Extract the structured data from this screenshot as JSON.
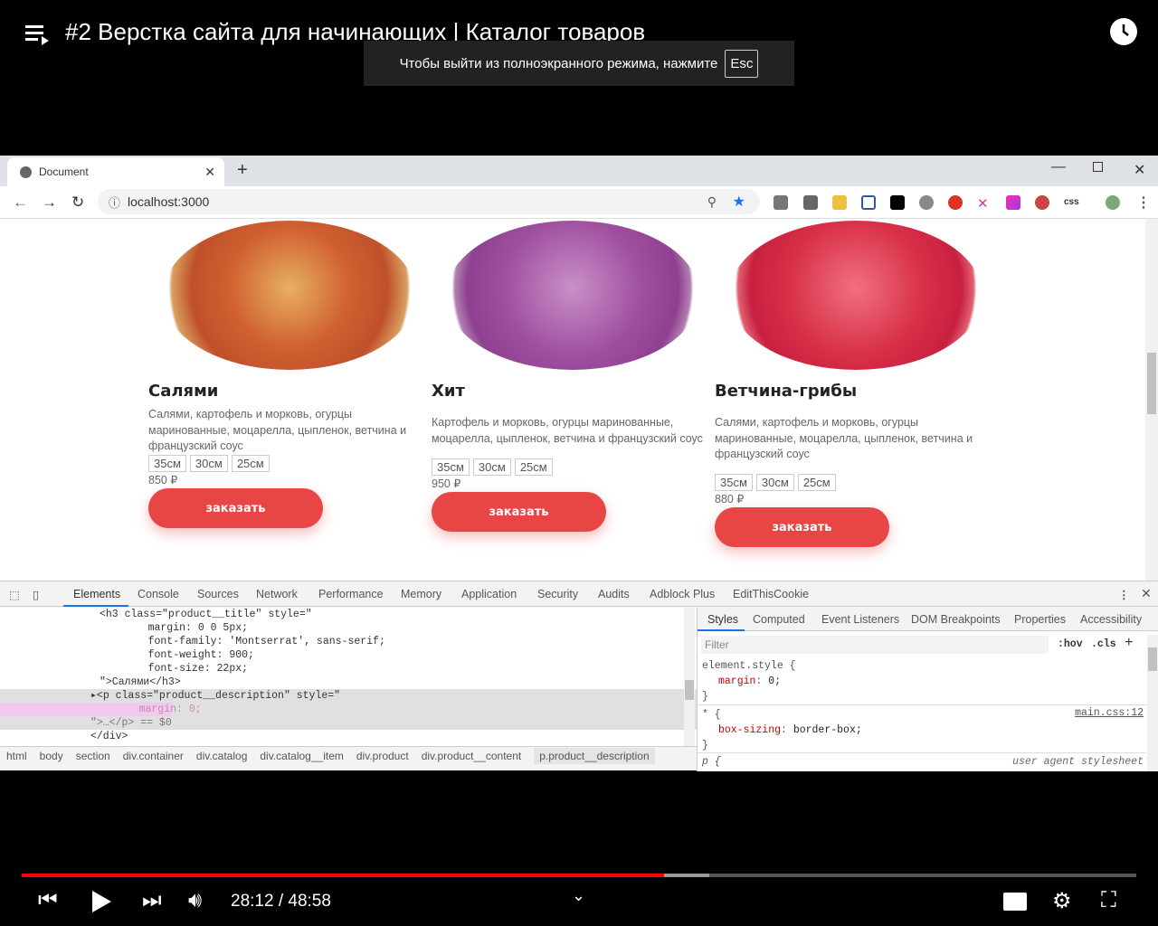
{
  "video": {
    "title": "#2 Верстка сайта для начинающих | Каталог товаров",
    "toast": "Чтобы выйти из полноэкранного режима, нажмите",
    "toast_key": "Esc",
    "time": "28:12 / 48:58",
    "played": 0.576,
    "buffered": 0.617,
    "accent": "#ff0000"
  },
  "browser": {
    "tab_title": "Document",
    "url": "localhost:3000",
    "ext_css": "css"
  },
  "products": [
    {
      "title": "Салями",
      "desc": "Салями, картофель и морковь, огурцы маринованные, моцарелла, цыпленок, ветчина и французский соус",
      "sizes": [
        "35см",
        "30см",
        "25см"
      ],
      "price": "850 ₽",
      "button": "заказать"
    },
    {
      "title": "Хит",
      "desc": "Картофель и морковь, огурцы маринованные, моцарелла, цыпленок, ветчина и французский соус",
      "sizes": [
        "35см",
        "30см",
        "25см"
      ],
      "price": "950 ₽",
      "button": "заказать"
    },
    {
      "title": "Ветчина-грибы",
      "desc": "Салями, картофель и морковь, огурцы маринованные, моцарелла, цыпленок, ветчина и французский соус",
      "sizes": [
        "35см",
        "30см",
        "25см"
      ],
      "price": "880 ₽",
      "button": "заказать"
    }
  ],
  "devtools": {
    "tabs": [
      "Elements",
      "Console",
      "Sources",
      "Network",
      "Performance",
      "Memory",
      "Application",
      "Security",
      "Audits",
      "Adblock Plus",
      "EditThisCookie"
    ],
    "code": [
      "<h3 class=\"product__title\" style=\"",
      "    margin: 0 0 5px;",
      "    font-family: 'Montserrat', sans-serif;",
      "    font-weight: 900;",
      "    font-size: 22px;",
      "\">Салями</h3>",
      "▸<p class=\"product__description\" style=\"",
      "    margin: 0;",
      "\">…</p> == $0",
      "</div>"
    ],
    "crumbs": [
      "html",
      "body",
      "section",
      "div.container",
      "div.catalog",
      "div.catalog__item",
      "div.product",
      "div.product__content",
      "p.product__description"
    ],
    "style_tabs": [
      "Styles",
      "Computed",
      "Event Listeners",
      "DOM Breakpoints",
      "Properties",
      "Accessibility"
    ],
    "filter_placeholder": "Filter",
    "hov": ":hov",
    "cls": ".cls",
    "rule1_sel": "element.style {",
    "rule1_prop": "margin",
    "rule1_val": "0;",
    "rule2_sel": "* {",
    "rule2_src": "main.css:12",
    "rule2_prop": "box-sizing",
    "rule2_val": "border-box;",
    "rule3_sel": "p {",
    "rule3_src": "user agent stylesheet"
  }
}
